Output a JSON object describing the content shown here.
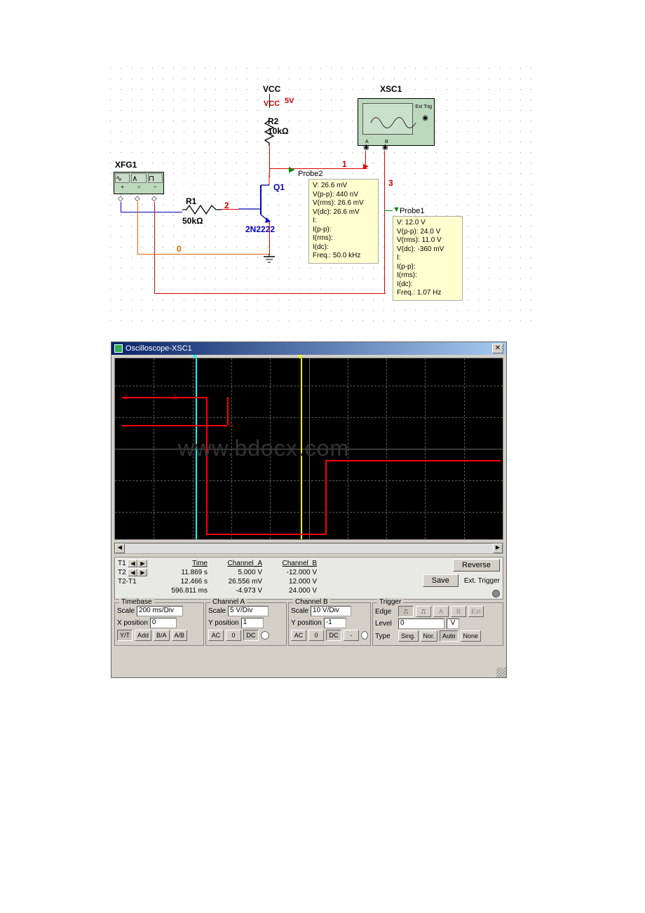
{
  "schematic": {
    "vcc_label": "VCC",
    "vcc2_label": "VCC",
    "vcc_value": "5V",
    "r2_name": "R2",
    "r2_value": "10kΩ",
    "r1_name": "R1",
    "r1_value": "50kΩ",
    "q1_name": "Q1",
    "q1_model": "2N2222",
    "xfg1": "XFG1",
    "xsc1": "XSC1",
    "xsc_ext": "Ext Trig",
    "xsc_a": "A",
    "xsc_b": "B",
    "net0": "0",
    "net1": "1",
    "net2": "2",
    "net3": "3",
    "probe1_label": "Probe1",
    "probe2_label": "Probe2",
    "probe2": {
      "v": "V: 26.6 mV",
      "vpp": "V(p-p): 440 nV",
      "vrms": "V(rms): 26.6 mV",
      "vdc": "V(dc): 26.6 mV",
      "i": "I:",
      "ipp": "I(p-p):",
      "irms": "I(rms):",
      "idc": "I(dc):",
      "freq": "Freq.: 50.0 kHz"
    },
    "probe1": {
      "v": "V: 12.0 V",
      "vpp": "V(p-p): 24.0 V",
      "vrms": "V(rms): 11.0 V",
      "vdc": "V(dc): -360 mV",
      "i": "I:",
      "ipp": "I(p-p):",
      "irms": "I(rms):",
      "idc": "I(dc):",
      "freq": "Freq.: 1.07 Hz"
    }
  },
  "scope": {
    "title": "Oscilloscope-XSC1",
    "cursor": {
      "time_hdr": "Time",
      "cha_hdr": "Channel_A",
      "chb_hdr": "Channel_B",
      "t1_label": "T1",
      "t2_label": "T2",
      "diff_label": "T2-T1",
      "t1_time": "11.869 s",
      "t1_a": "5.000 V",
      "t1_b": "-12.000 V",
      "t2_time": "12.466 s",
      "t2_a": "26.556 mV",
      "t2_b": "12.000 V",
      "diff_time": "596.811 ms",
      "diff_a": "-4.973 V",
      "diff_b": "24.000 V",
      "reverse": "Reverse",
      "save": "Save",
      "ext_trigger": "Ext. Trigger"
    },
    "timebase": {
      "legend": "Timebase",
      "scale_label": "Scale",
      "scale_value": "200 ms/Div",
      "xpos_label": "X position",
      "xpos_value": "0",
      "yt": "Y/T",
      "add": "Add",
      "ba": "B/A",
      "ab": "A/B"
    },
    "chA": {
      "legend": "Channel A",
      "scale_label": "Scale",
      "scale_value": "5  V/Div",
      "ypos_label": "Y position",
      "ypos_value": "1",
      "ac": "AC",
      "zero": "0",
      "dc": "DC"
    },
    "chB": {
      "legend": "Channel B",
      "scale_label": "Scale",
      "scale_value": "10  V/Div",
      "ypos_label": "Y position",
      "ypos_value": "-1",
      "ac": "AC",
      "zero": "0",
      "dc": "DC",
      "minus": "-"
    },
    "trigger": {
      "legend": "Trigger",
      "edge_label": "Edge",
      "level_label": "Level",
      "level_value": "0",
      "level_unit": "V",
      "type_label": "Type",
      "rise": "↗",
      "fall": "↘",
      "a": "A",
      "b": "B",
      "ext": "Ext",
      "sing": "Sing.",
      "nor": "Nor.",
      "auto": "Auto",
      "none": "None"
    }
  }
}
